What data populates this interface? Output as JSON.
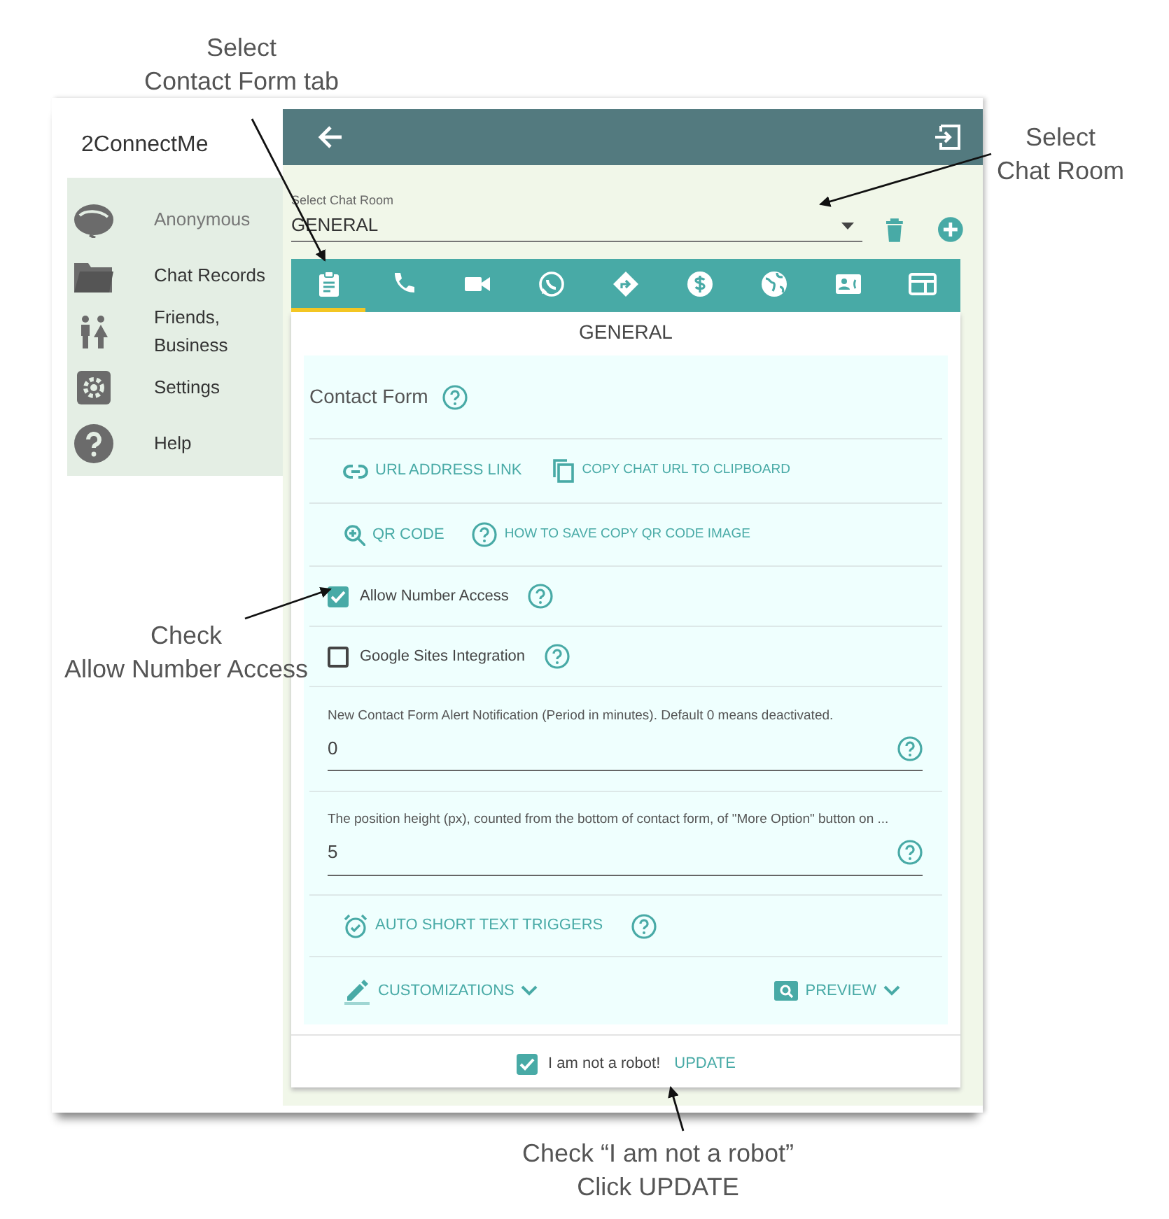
{
  "annotations": [
    {
      "lines": [
        "Select",
        "Contact Form tab"
      ]
    },
    {
      "lines": [
        "Select",
        "Chat Room"
      ]
    },
    {
      "lines": [
        "Check",
        "Allow Number Access"
      ]
    },
    {
      "lines": [
        "Check “I am not a  robot”",
        "Click UPDATE"
      ]
    }
  ],
  "app": {
    "title": "2ConnectMe"
  },
  "sidebar": {
    "items": [
      {
        "label": "Anonymous",
        "dimmed": true
      },
      {
        "label": "Chat Records",
        "dimmed": false
      },
      {
        "label": "Friends, Business",
        "dimmed": false
      },
      {
        "label": "Settings",
        "dimmed": false
      },
      {
        "label": "Help",
        "dimmed": false
      }
    ]
  },
  "room_select": {
    "label": "Select Chat Room",
    "value": "GENERAL"
  },
  "tabs": [
    {
      "selected": true
    },
    {
      "selected": false
    },
    {
      "selected": false
    },
    {
      "selected": false
    },
    {
      "selected": false
    },
    {
      "selected": false
    },
    {
      "selected": false
    },
    {
      "selected": false
    },
    {
      "selected": false
    }
  ],
  "room_title": "GENERAL",
  "section_title": "Contact Form",
  "link_rows": [
    [
      {
        "label": "URL ADDRESS LINK"
      },
      {
        "label": "COPY CHAT URL TO CLIPBOARD"
      }
    ],
    [
      {
        "label": "QR CODE"
      },
      {
        "label": "HOW TO SAVE COPY QR CODE IMAGE"
      }
    ]
  ],
  "checkboxes": [
    {
      "label": "Allow Number Access",
      "checked": true
    },
    {
      "label": "Google Sites Integration",
      "checked": false
    }
  ],
  "fields": [
    {
      "label": "New Contact Form Alert Notification (Period in minutes). Default 0 means deactivated.",
      "value": "0"
    },
    {
      "label": "The position height (px), counted from the bottom of contact form, of \"More Option\" button on ...",
      "value": "5"
    }
  ],
  "triggers_button": "AUTO SHORT TEXT TRIGGERS",
  "customizations": "CUSTOMIZATIONS",
  "preview": "PREVIEW",
  "robot": {
    "label": "I am not a robot!",
    "checked": true
  },
  "update": "UPDATE"
}
